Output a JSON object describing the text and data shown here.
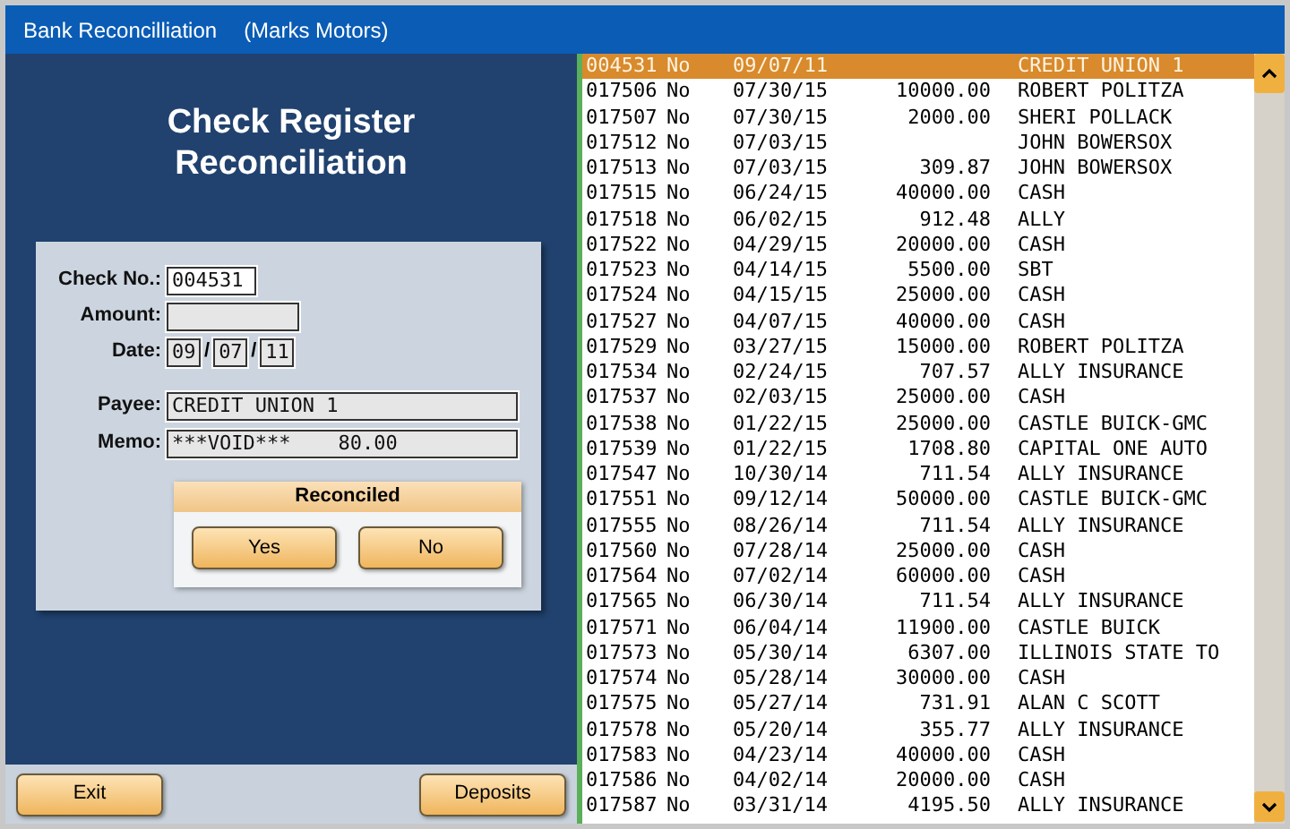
{
  "window": {
    "title": "Bank Reconcilliation",
    "company": "(Marks Motors)"
  },
  "heading": "Check Register Reconciliation",
  "form": {
    "check_no": {
      "label": "Check No.:",
      "value": "004531"
    },
    "amount": {
      "label": "Amount:"
    },
    "date": {
      "label": "Date:",
      "month": "09",
      "day": "07",
      "year": "11",
      "separator": "/"
    },
    "payee": {
      "label": "Payee:",
      "value": "CREDIT UNION 1"
    },
    "memo": {
      "label": "Memo:",
      "value": "***VOID***    80.00"
    }
  },
  "reconciled": {
    "title": "Reconciled",
    "buttons": [
      "Yes",
      "No"
    ]
  },
  "footer_buttons": [
    "Exit",
    "Deposits"
  ],
  "checks": [
    {
      "check": "004531",
      "status": "No",
      "date": "09/07/11",
      "payee": "CREDIT UNION 1",
      "selected": true
    },
    {
      "check": "017506",
      "status": "No",
      "date": "07/30/15",
      "amount": "10000.00",
      "payee": "ROBERT POLITZA",
      "selected": false
    },
    {
      "check": "017507",
      "status": "No",
      "date": "07/30/15",
      "amount": "2000.00",
      "payee": "SHERI POLLACK",
      "selected": false
    },
    {
      "check": "017512",
      "status": "No",
      "date": "07/03/15",
      "payee": "JOHN BOWERSOX",
      "selected": false
    },
    {
      "check": "017513",
      "status": "No",
      "date": "07/03/15",
      "amount": "309.87",
      "payee": "JOHN BOWERSOX",
      "selected": false
    },
    {
      "check": "017515",
      "status": "No",
      "date": "06/24/15",
      "amount": "40000.00",
      "payee": "CASH",
      "selected": false
    },
    {
      "check": "017518",
      "status": "No",
      "date": "06/02/15",
      "amount": "912.48",
      "payee": "ALLY",
      "selected": false
    },
    {
      "check": "017522",
      "status": "No",
      "date": "04/29/15",
      "amount": "20000.00",
      "payee": "CASH",
      "selected": false
    },
    {
      "check": "017523",
      "status": "No",
      "date": "04/14/15",
      "amount": "5500.00",
      "payee": "SBT",
      "selected": false
    },
    {
      "check": "017524",
      "status": "No",
      "date": "04/15/15",
      "amount": "25000.00",
      "payee": "CASH",
      "selected": false
    },
    {
      "check": "017527",
      "status": "No",
      "date": "04/07/15",
      "amount": "40000.00",
      "payee": "CASH",
      "selected": false
    },
    {
      "check": "017529",
      "status": "No",
      "date": "03/27/15",
      "amount": "15000.00",
      "payee": "ROBERT POLITZA",
      "selected": false
    },
    {
      "check": "017534",
      "status": "No",
      "date": "02/24/15",
      "amount": "707.57",
      "payee": "ALLY INSURANCE",
      "selected": false
    },
    {
      "check": "017537",
      "status": "No",
      "date": "02/03/15",
      "amount": "25000.00",
      "payee": "CASH",
      "selected": false
    },
    {
      "check": "017538",
      "status": "No",
      "date": "01/22/15",
      "amount": "25000.00",
      "payee": "CASTLE BUICK-GMC",
      "selected": false
    },
    {
      "check": "017539",
      "status": "No",
      "date": "01/22/15",
      "amount": "1708.80",
      "payee": "CAPITAL ONE AUTO",
      "selected": false
    },
    {
      "check": "017547",
      "status": "No",
      "date": "10/30/14",
      "amount": "711.54",
      "payee": "ALLY INSURANCE",
      "selected": false
    },
    {
      "check": "017551",
      "status": "No",
      "date": "09/12/14",
      "amount": "50000.00",
      "payee": "CASTLE BUICK-GMC",
      "selected": false
    },
    {
      "check": "017555",
      "status": "No",
      "date": "08/26/14",
      "amount": "711.54",
      "payee": "ALLY INSURANCE",
      "selected": false
    },
    {
      "check": "017560",
      "status": "No",
      "date": "07/28/14",
      "amount": "25000.00",
      "payee": "CASH",
      "selected": false
    },
    {
      "check": "017564",
      "status": "No",
      "date": "07/02/14",
      "amount": "60000.00",
      "payee": "CASH",
      "selected": false
    },
    {
      "check": "017565",
      "status": "No",
      "date": "06/30/14",
      "amount": "711.54",
      "payee": "ALLY INSURANCE",
      "selected": false
    },
    {
      "check": "017571",
      "status": "No",
      "date": "06/04/14",
      "amount": "11900.00",
      "payee": "CASTLE BUICK",
      "selected": false
    },
    {
      "check": "017573",
      "status": "No",
      "date": "05/30/14",
      "amount": "6307.00",
      "payee": "ILLINOIS STATE TO",
      "selected": false
    },
    {
      "check": "017574",
      "status": "No",
      "date": "05/28/14",
      "amount": "30000.00",
      "payee": "CASH",
      "selected": false
    },
    {
      "check": "017575",
      "status": "No",
      "date": "05/27/14",
      "amount": "731.91",
      "payee": "ALAN C SCOTT",
      "selected": false
    },
    {
      "check": "017578",
      "status": "No",
      "date": "05/20/14",
      "amount": "355.77",
      "payee": "ALLY INSURANCE",
      "selected": false
    },
    {
      "check": "017583",
      "status": "No",
      "date": "04/23/14",
      "amount": "40000.00",
      "payee": "CASH",
      "selected": false
    },
    {
      "check": "017586",
      "status": "No",
      "date": "04/02/14",
      "amount": "20000.00",
      "payee": "CASH",
      "selected": false
    },
    {
      "check": "017587",
      "status": "No",
      "date": "03/31/14",
      "amount": "4195.50",
      "payee": "ALLY INSURANCE",
      "selected": false
    }
  ]
}
